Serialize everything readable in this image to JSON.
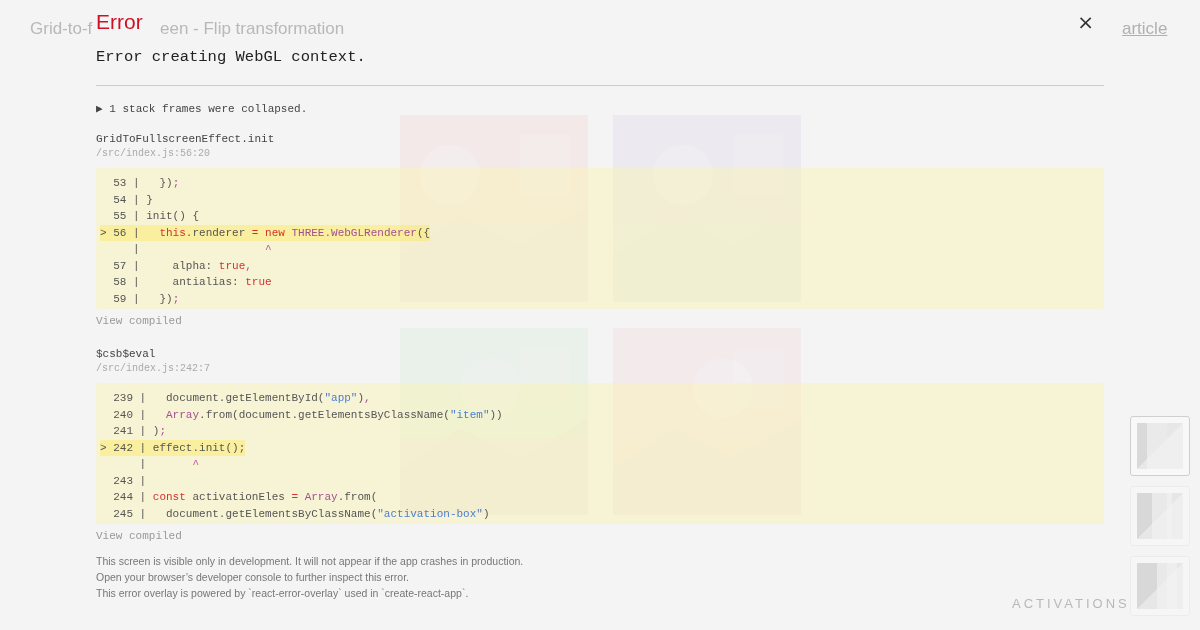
{
  "page": {
    "title_parts": [
      "Grid-to-f",
      "een - Flip transformation"
    ],
    "link": "article",
    "section_label": "ACTIVATIONS",
    "tiles": [
      {
        "kind": "picture"
      },
      {
        "kind": "picture"
      },
      {
        "kind": "picture"
      },
      {
        "kind": "picture"
      }
    ],
    "thumbnails": [
      {
        "kind": "picture",
        "selected": true
      },
      {
        "kind": "picture",
        "selected": false
      },
      {
        "kind": "picture",
        "selected": false
      }
    ]
  },
  "overlay": {
    "heading": "Error",
    "close_label": "×",
    "message": "Error creating WebGL context.",
    "collapsed_note": "▶ 1 stack frames were collapsed.",
    "frames": [
      {
        "name": "GridToFullscreenEffect.init",
        "file": "/src/index.js:56:20",
        "view_compiled": "View compiled",
        "lines": [
          {
            "gutter": "  53 |",
            "highlighted": false,
            "tokens": [
              {
                "text": "   })",
                "kind": "plain"
              },
              {
                "text": ";",
                "kind": "punct"
              }
            ]
          },
          {
            "gutter": "  54 |",
            "highlighted": false,
            "tokens": [
              {
                "text": " }",
                "kind": "plain"
              }
            ]
          },
          {
            "gutter": "  55 |",
            "highlighted": false,
            "tokens": [
              {
                "text": " init() {",
                "kind": "plain"
              }
            ]
          },
          {
            "gutter": "> 56 |",
            "highlighted": true,
            "tokens": [
              {
                "text": "   this",
                "kind": "keyword"
              },
              {
                "text": ".renderer ",
                "kind": "plain"
              },
              {
                "text": "= ",
                "kind": "keyword"
              },
              {
                "text": "new",
                "kind": "keyword"
              },
              {
                "text": " THREE.WebGLRenderer",
                "kind": "builtin"
              },
              {
                "text": "({",
                "kind": "plain"
              }
            ]
          },
          {
            "gutter": "     |",
            "highlighted": false,
            "tokens": [
              {
                "text": "                   ^",
                "kind": "caret"
              }
            ]
          },
          {
            "gutter": "  57 |",
            "highlighted": false,
            "tokens": [
              {
                "text": "     alpha: ",
                "kind": "plain"
              },
              {
                "text": "true",
                "kind": "keyword"
              },
              {
                "text": ",",
                "kind": "punct"
              }
            ]
          },
          {
            "gutter": "  58 |",
            "highlighted": false,
            "tokens": [
              {
                "text": "     antialias: ",
                "kind": "plain"
              },
              {
                "text": "true",
                "kind": "keyword"
              }
            ]
          },
          {
            "gutter": "  59 |",
            "highlighted": false,
            "tokens": [
              {
                "text": "   })",
                "kind": "plain"
              },
              {
                "text": ";",
                "kind": "punct"
              }
            ]
          }
        ]
      },
      {
        "name": "$csb$eval",
        "file": "/src/index.js:242:7",
        "view_compiled": "View compiled",
        "lines": [
          {
            "gutter": "  239 |",
            "highlighted": false,
            "tokens": [
              {
                "text": "   document.getElementById(",
                "kind": "plain"
              },
              {
                "text": "\"app\"",
                "kind": "string"
              },
              {
                "text": ")",
                "kind": "plain"
              },
              {
                "text": ",",
                "kind": "punct"
              }
            ]
          },
          {
            "gutter": "  240 |",
            "highlighted": false,
            "tokens": [
              {
                "text": "   Array",
                "kind": "builtin"
              },
              {
                "text": ".from(document.getElementsByClassName(",
                "kind": "plain"
              },
              {
                "text": "\"item\"",
                "kind": "string"
              },
              {
                "text": "))",
                "kind": "plain"
              }
            ]
          },
          {
            "gutter": "  241 |",
            "highlighted": false,
            "tokens": [
              {
                "text": " )",
                "kind": "plain"
              },
              {
                "text": ";",
                "kind": "punct"
              }
            ]
          },
          {
            "gutter": "> 242 |",
            "highlighted": true,
            "tokens": [
              {
                "text": " effect.init();",
                "kind": "plain"
              }
            ]
          },
          {
            "gutter": "      |",
            "highlighted": false,
            "tokens": [
              {
                "text": "       ^",
                "kind": "caret"
              }
            ]
          },
          {
            "gutter": "  243 |",
            "highlighted": false
          },
          {
            "gutter": "  244 |",
            "highlighted": false,
            "tokens": [
              {
                "text": " const",
                "kind": "keyword"
              },
              {
                "text": " activationEles ",
                "kind": "plain"
              },
              {
                "text": "= ",
                "kind": "keyword"
              },
              {
                "text": "Array",
                "kind": "builtin"
              },
              {
                "text": ".from(",
                "kind": "plain"
              }
            ]
          },
          {
            "gutter": "  245 |",
            "highlighted": false,
            "tokens": [
              {
                "text": "   document.getElementsByClassName(",
                "kind": "plain"
              },
              {
                "text": "\"activation-box\"",
                "kind": "string"
              },
              {
                "text": ")",
                "kind": "plain"
              }
            ]
          }
        ]
      }
    ],
    "footer": [
      "This screen is visible only in development. It will not appear if the app crashes in production.",
      "Open your browser’s developer console to further inspect this error.",
      "This error overlay is powered by `react-error-overlay` used in `create-react-app`."
    ]
  }
}
